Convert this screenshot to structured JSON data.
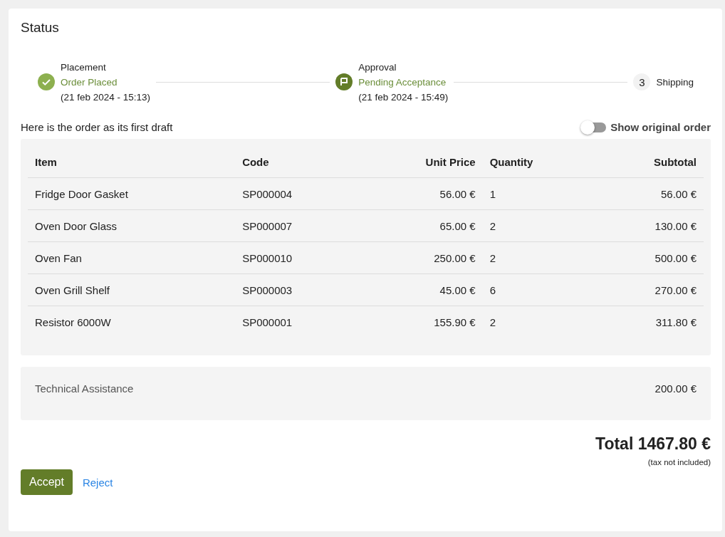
{
  "title": "Status",
  "steps": [
    {
      "kind": "done",
      "label": "Placement",
      "status": "Order Placed",
      "date": "(21 feb 2024 - 15:13)"
    },
    {
      "kind": "current",
      "label": "Approval",
      "status": "Pending Acceptance",
      "date": "(21 feb 2024 - 15:49)"
    },
    {
      "kind": "pending",
      "number": "3",
      "label": "Shipping"
    }
  ],
  "draft_note": "Here is the order as its first draft",
  "toggle": {
    "label": "Show original order",
    "on": false
  },
  "table": {
    "columns": [
      "Item",
      "Code",
      "Unit Price",
      "Quantity",
      "Subtotal"
    ],
    "rows": [
      [
        "Fridge Door Gasket",
        "SP000004",
        "56.00 €",
        "1",
        "56.00 €"
      ],
      [
        "Oven Door Glass",
        "SP000007",
        "65.00 €",
        "2",
        "130.00 €"
      ],
      [
        "Oven Fan",
        "SP000010",
        "250.00 €",
        "2",
        "500.00 €"
      ],
      [
        "Oven Grill Shelf",
        "SP000003",
        "45.00 €",
        "6",
        "270.00 €"
      ],
      [
        "Resistor 6000W",
        "SP000001",
        "155.90 €",
        "2",
        "311.80 €"
      ]
    ]
  },
  "extra": {
    "label": "Technical Assistance",
    "amount": "200.00 €"
  },
  "total": "Total 1467.80 €",
  "tax_note": "(tax not included)",
  "buttons": [
    {
      "kind": "primary",
      "label": "Accept"
    },
    {
      "kind": "link",
      "label": "Reject"
    }
  ]
}
